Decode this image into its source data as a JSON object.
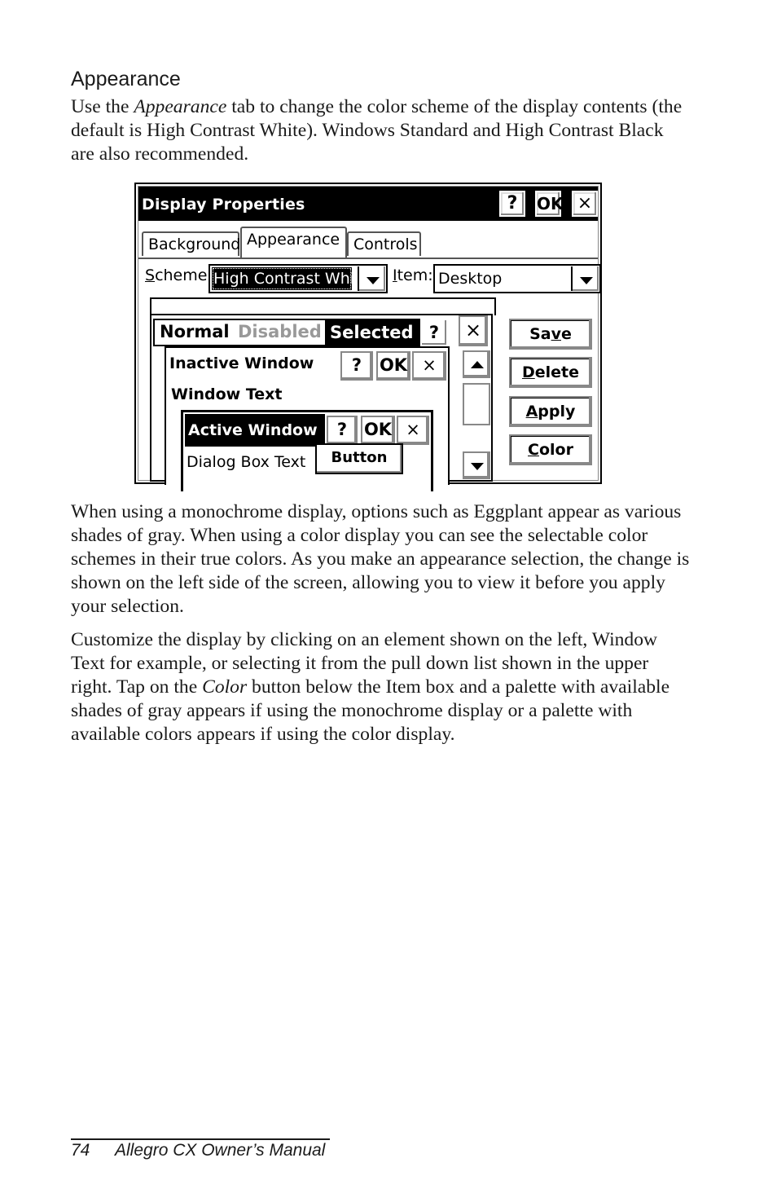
{
  "section": {
    "heading": "Appearance",
    "intro": {
      "before": "Use the ",
      "em": "Appearance",
      "after": " tab to change the color scheme of the display contents (the default is High Contrast White). Windows Standard and High Contrast Black are also recommended."
    }
  },
  "dialog": {
    "title": "Display Properties",
    "title_buttons": {
      "help": "?",
      "ok": "OK",
      "close": "×"
    },
    "tabs": [
      {
        "label": "Background",
        "active": false
      },
      {
        "label": "Appearance",
        "active": true
      },
      {
        "label": "Controls",
        "active": false
      }
    ],
    "scheme": {
      "label_accel": "S",
      "label_rest": "cheme:",
      "value": "High Contrast White"
    },
    "item": {
      "label_accel": "I",
      "label_rest": "tem:",
      "value": "Desktop"
    },
    "preview": {
      "menu": {
        "normal": "Normal",
        "disabled": "Disabled",
        "selected": "Selected",
        "help": "?",
        "close": "×"
      },
      "inactive_window": {
        "title": "Inactive Window",
        "help": "?",
        "ok": "OK",
        "close": "×",
        "window_text": "Window Text"
      },
      "active_window": {
        "title": "Active Window",
        "help": "?",
        "ok": "OK",
        "close": "×",
        "dialog_text": "Dialog Box Text",
        "button": "Button"
      }
    },
    "side_buttons": [
      {
        "pre": "Sa",
        "accel": "v",
        "post": "e"
      },
      {
        "pre": "",
        "accel": "D",
        "post": "elete"
      },
      {
        "pre": "",
        "accel": "A",
        "post": "pply"
      },
      {
        "pre": "",
        "accel": "C",
        "post": "olor"
      }
    ]
  },
  "paragraphs": {
    "p2": "When using a monochrome display, options such as Eggplant appear as various shades of gray. When using a color display you can see the selectable color schemes in their true colors. As you make an appearance selection, the change is shown on the left side of the screen, allowing you to view it before you apply your selection.",
    "p3": {
      "before": "Customize the display by clicking on an element shown on the left, Window Text for example, or selecting it from the pull down list shown in the upper right. Tap on the ",
      "em": "Color",
      "after": " button below the Item box and a palette with available shades of gray appears if using the monochrome display or a palette with available colors appears if using the color display."
    }
  },
  "footer": {
    "page_number": "74",
    "title": "Allegro CX Owner’s Manual"
  }
}
